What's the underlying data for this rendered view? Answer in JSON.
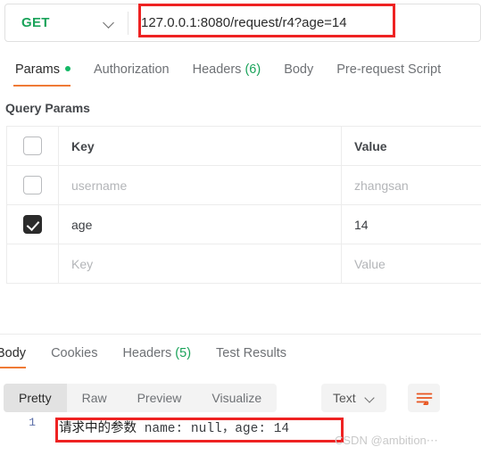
{
  "url_bar": {
    "method": "GET",
    "method_color": "#1aa35a",
    "url": "127.0.0.1:8080/request/r4?age=14"
  },
  "request_tabs": [
    {
      "label": "Params",
      "has_dot": true,
      "active": true
    },
    {
      "label": "Authorization",
      "has_dot": false,
      "active": false
    },
    {
      "label": "Headers",
      "count": "(6)",
      "has_dot": false,
      "active": false
    },
    {
      "label": "Body",
      "has_dot": false,
      "active": false
    },
    {
      "label": "Pre-request Script",
      "has_dot": false,
      "active": false
    }
  ],
  "query_params": {
    "section_title": "Query Params",
    "columns": {
      "key": "Key",
      "value": "Value"
    },
    "rows": [
      {
        "checked": false,
        "has_checkbox": true,
        "key": "username",
        "value": "zhangsan",
        "placeholder": true
      },
      {
        "checked": true,
        "has_checkbox": true,
        "key": "age",
        "value": "14",
        "placeholder": false
      },
      {
        "checked": false,
        "has_checkbox": false,
        "key": "Key",
        "value": "Value",
        "placeholder": true
      }
    ]
  },
  "response_tabs": [
    {
      "label": "Body",
      "active": true
    },
    {
      "label": "Cookies",
      "active": false
    },
    {
      "label": "Headers",
      "count": "(5)",
      "active": false
    },
    {
      "label": "Test Results",
      "active": false
    }
  ],
  "body_toolbar": {
    "views": [
      {
        "label": "Pretty",
        "active": true
      },
      {
        "label": "Raw",
        "active": false
      },
      {
        "label": "Preview",
        "active": false
      },
      {
        "label": "Visualize",
        "active": false
      }
    ],
    "format": "Text",
    "wrap_icon": "wrap-lines-icon"
  },
  "response_body": {
    "line_number": "1",
    "text_cjk": "请求中的参数",
    "text_rest": " name: null，age: 14"
  },
  "watermark": "CSDN @ambition⋯",
  "highlight_color": "#ee2222"
}
